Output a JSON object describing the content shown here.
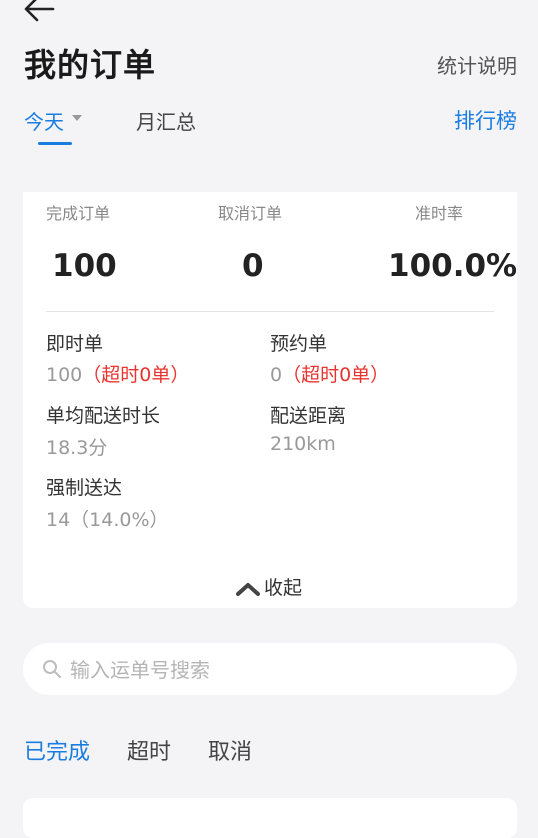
{
  "header": {
    "title": "我的订单",
    "stats_help": "统计说明"
  },
  "tabs": {
    "today": "今天",
    "month": "月汇总",
    "ranking": "排行榜"
  },
  "summary": {
    "completed_label": "完成订单",
    "completed_value": "100",
    "cancelled_label": "取消订单",
    "cancelled_value": "0",
    "ontime_label": "准时率",
    "ontime_value": "100.0%"
  },
  "details": {
    "instant_label": "即时单",
    "instant_value": "100",
    "instant_overtime": "（超时0单）",
    "reserve_label": "预约单",
    "reserve_value": "0",
    "reserve_overtime": "（超时0单）",
    "avg_time_label": "单均配送时长",
    "avg_time_value": "18.3分",
    "distance_label": "配送距离",
    "distance_value": "210km",
    "forced_label": "强制送达",
    "forced_value": "14（14.0%）",
    "collapse": "收起"
  },
  "search": {
    "placeholder": "输入运单号搜索"
  },
  "filters": {
    "completed": "已完成",
    "overtime": "超时",
    "cancelled": "取消"
  },
  "colors": {
    "accent": "#1a7de0",
    "warning": "#e8342f",
    "background": "#f4f4f6"
  }
}
